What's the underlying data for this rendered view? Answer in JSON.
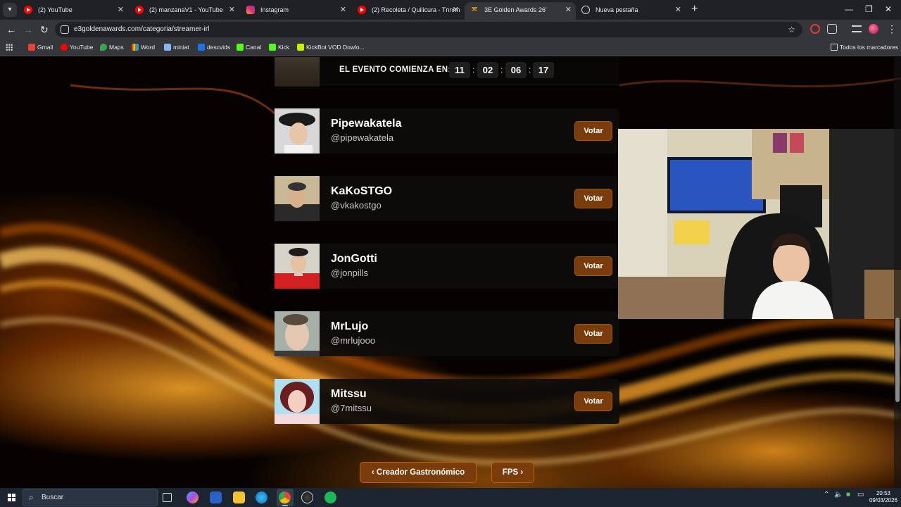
{
  "browser": {
    "tabs": [
      {
        "title": "(2) YouTube",
        "icon": "youtube-icon",
        "active": false
      },
      {
        "title": "(2) manzanaV1 - YouTube",
        "icon": "youtube-icon",
        "active": false
      },
      {
        "title": "Instagram",
        "icon": "instagram-icon",
        "active": false
      },
      {
        "title": "(2) Recoleta / Quilicura - Tnnnn",
        "icon": "youtube-icon",
        "active": false
      },
      {
        "title": "3E Golden Awards 26'",
        "icon": "golden-awards-icon",
        "active": true
      },
      {
        "title": "Nueva pestaña",
        "icon": "globe-icon",
        "active": false
      }
    ],
    "favicon_text": "3E",
    "url": "e3goldenawards.com/categoria/streamer-irl",
    "bookmarks": [
      {
        "label": "Gmail",
        "color": "#ea4335"
      },
      {
        "label": "YouTube",
        "color": "#ff0000"
      },
      {
        "label": "Maps",
        "color": "#34a853"
      },
      {
        "label": "Word",
        "color": "#f4b400"
      },
      {
        "label": "miniat",
        "color": "#8ab4f8"
      },
      {
        "label": "descvids",
        "color": "#1a73e8"
      },
      {
        "label": "Canal",
        "color": "#53fc18"
      },
      {
        "label": "Kick",
        "color": "#53fc18"
      },
      {
        "label": "KickBot VOD Dowlo...",
        "color": "#c8f000"
      }
    ],
    "all_bookmarks": "Todos los marcadores"
  },
  "countdown": {
    "label": "EL EVENTO COMIENZA EN:",
    "values": [
      "11",
      "02",
      "06",
      "17"
    ]
  },
  "nominees": [
    {
      "name": "Pipewakatela",
      "handle": "@pipewakatela",
      "vote_label": "Votar"
    },
    {
      "name": "KaKoSTGO",
      "handle": "@vkakostgo",
      "vote_label": "Votar"
    },
    {
      "name": "JonGotti",
      "handle": "@jonpills",
      "vote_label": "Votar"
    },
    {
      "name": "MrLujo",
      "handle": "@mrlujooo",
      "vote_label": "Votar"
    },
    {
      "name": "Mitssu",
      "handle": "@7mitssu",
      "vote_label": "Votar"
    }
  ],
  "category_nav": {
    "prev_label": "Creador Gastronómico",
    "next_label": "FPS"
  },
  "taskbar": {
    "search_placeholder": "Buscar",
    "time": "20:53",
    "date": "09/03/2026"
  },
  "colors": {
    "accent_button": "#7a3c0a",
    "background": "#050201",
    "glow": "#ffaa28"
  }
}
